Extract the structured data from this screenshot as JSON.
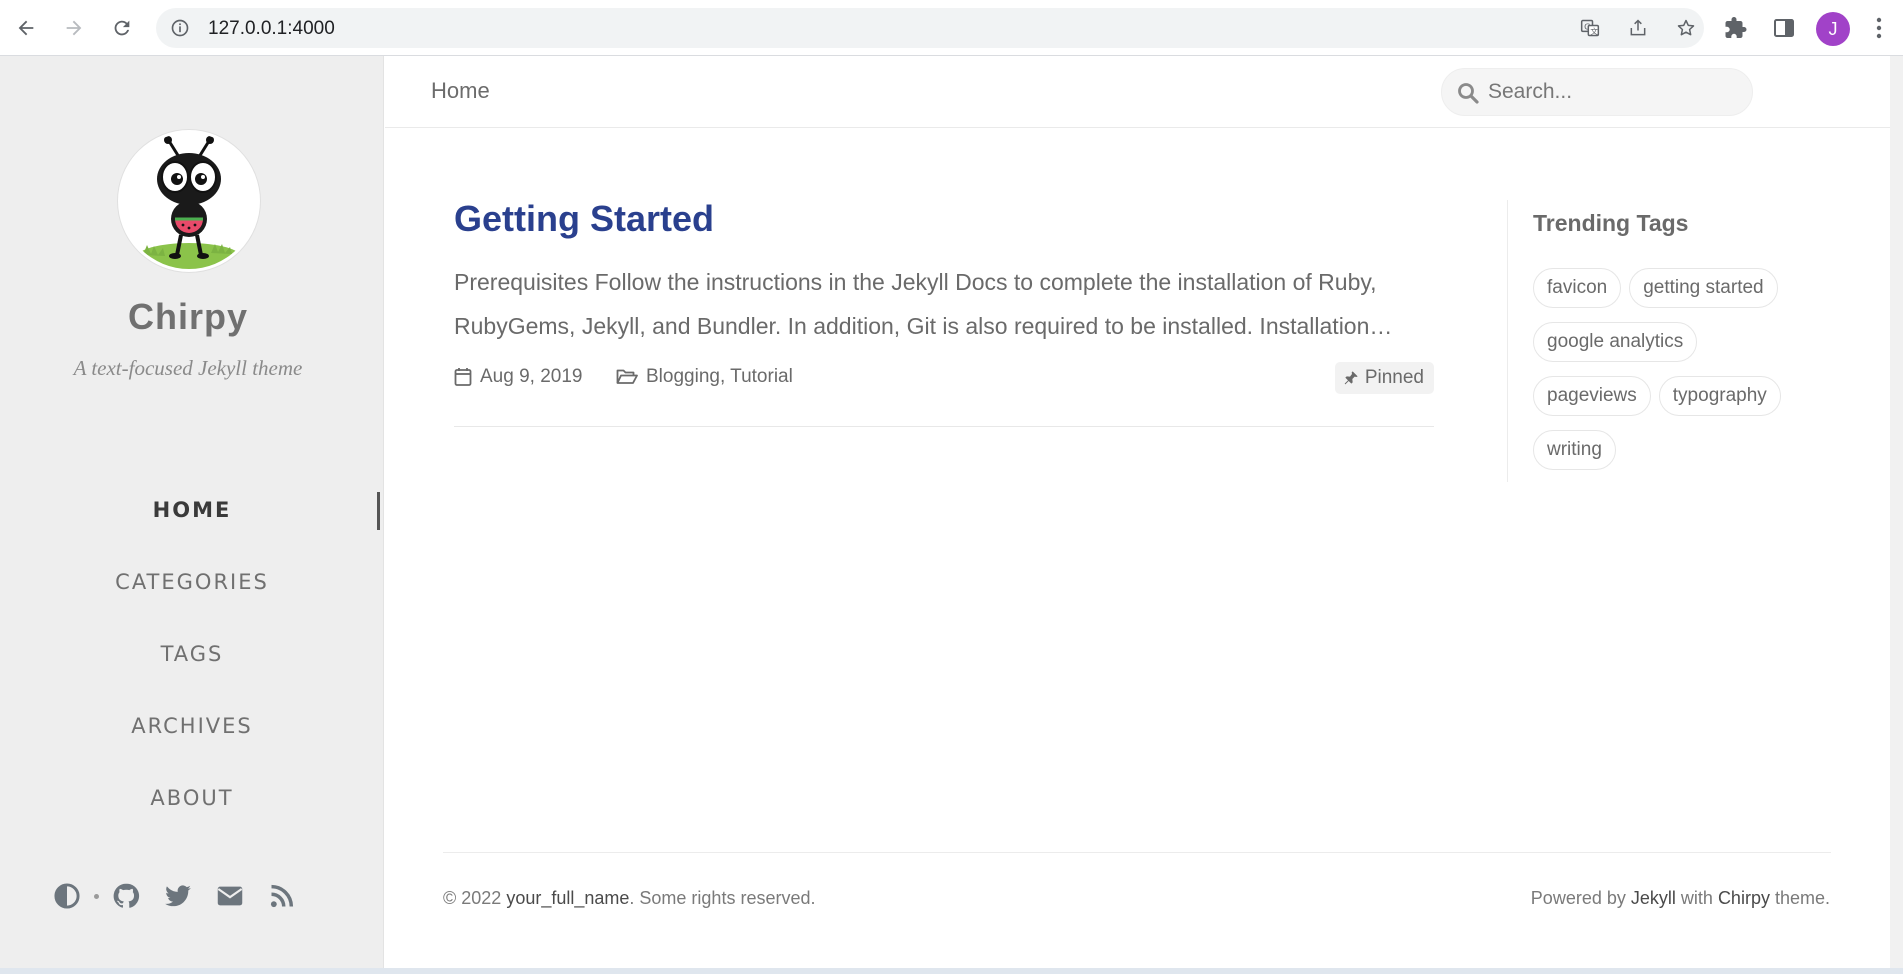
{
  "browser": {
    "url": "127.0.0.1:4000",
    "profile_initial": "J",
    "profile_color": "#a142c8"
  },
  "sidebar": {
    "site_title": "Chirpy",
    "site_subtitle": "A text-focused Jekyll theme",
    "nav": [
      {
        "label": "HOME",
        "active": true
      },
      {
        "label": "CATEGORIES",
        "active": false
      },
      {
        "label": "TAGS",
        "active": false
      },
      {
        "label": "ARCHIVES",
        "active": false
      },
      {
        "label": "ABOUT",
        "active": false
      }
    ],
    "bottom_icons": [
      "theme-toggle-icon",
      "github-icon",
      "twitter-icon",
      "email-icon",
      "rss-icon"
    ]
  },
  "topbar": {
    "breadcrumb": "Home",
    "search_placeholder": "Search..."
  },
  "post": {
    "title": "Getting Started",
    "excerpt": "Prerequisites Follow the instructions in the Jekyll Docs to complete the installation of Ruby, RubyGems, Jekyll, and Bundler. In addition, Git is also required to be installed. Installation…",
    "date": "Aug 9, 2019",
    "categories": [
      "Blogging",
      "Tutorial"
    ],
    "category_sep": ",",
    "pinned_label": "Pinned"
  },
  "trending": {
    "title": "Trending Tags",
    "tags": [
      "favicon",
      "getting started",
      "google analytics",
      "pageviews",
      "typography",
      "writing"
    ]
  },
  "footer": {
    "copyright_prefix": "© 2022",
    "owner": "your_full_name",
    "rights": ". Some rights reserved.",
    "powered_prefix": "Powered by",
    "jekyll": "Jekyll",
    "with": "with",
    "chirpy": "Chirpy",
    "theme_suffix": "theme."
  },
  "colors": {
    "title_link": "#2a408e",
    "sidebar_bg": "#eeeeee"
  }
}
